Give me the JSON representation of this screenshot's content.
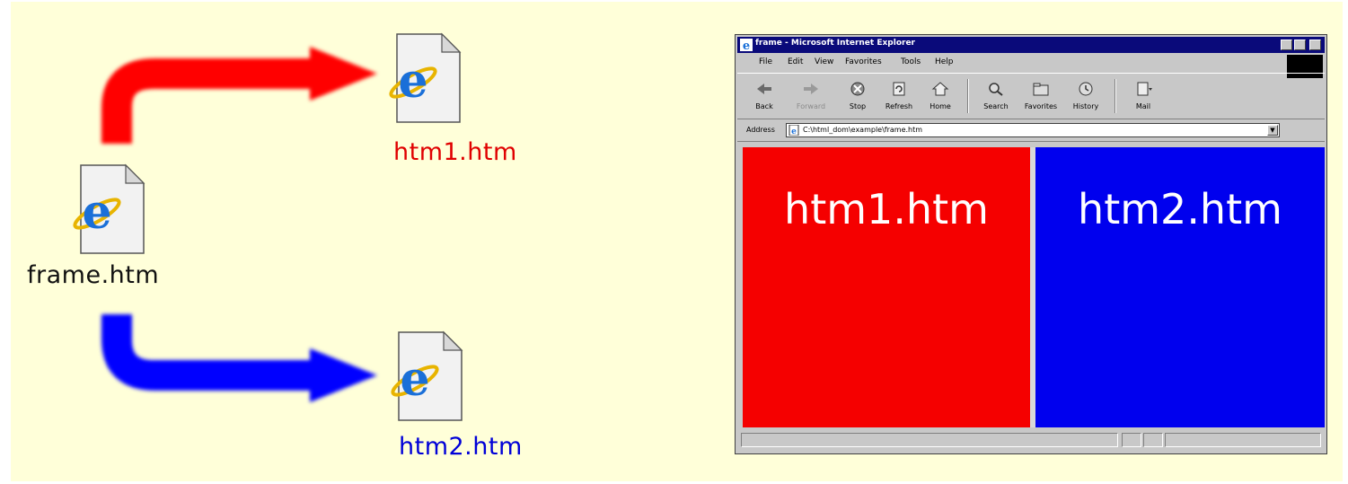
{
  "diagram": {
    "source_file": "frame.htm",
    "targets": [
      {
        "file": "htm1.htm",
        "color": "#e00000"
      },
      {
        "file": "htm2.htm",
        "color": "#0000d8"
      }
    ],
    "arrow_colors": {
      "top": "#ff0000",
      "bottom": "#0000ff"
    },
    "background": "#ffffd9"
  },
  "browser": {
    "title": "frame - Microsoft Internet Explorer",
    "menu": [
      "File",
      "Edit",
      "View",
      "Favorites",
      "Tools",
      "Help"
    ],
    "toolbar": [
      "Back",
      "Forward",
      "Stop",
      "Refresh",
      "Home",
      "Search",
      "Favorites",
      "History",
      "Mail"
    ],
    "address_label": "Address",
    "address_value": "C:\\html_dom\\example\\frame.htm",
    "frames": {
      "left": {
        "text": "htm1.htm",
        "color": "#f50000"
      },
      "right": {
        "text": "htm2.htm",
        "color": "#0000ee"
      }
    }
  }
}
